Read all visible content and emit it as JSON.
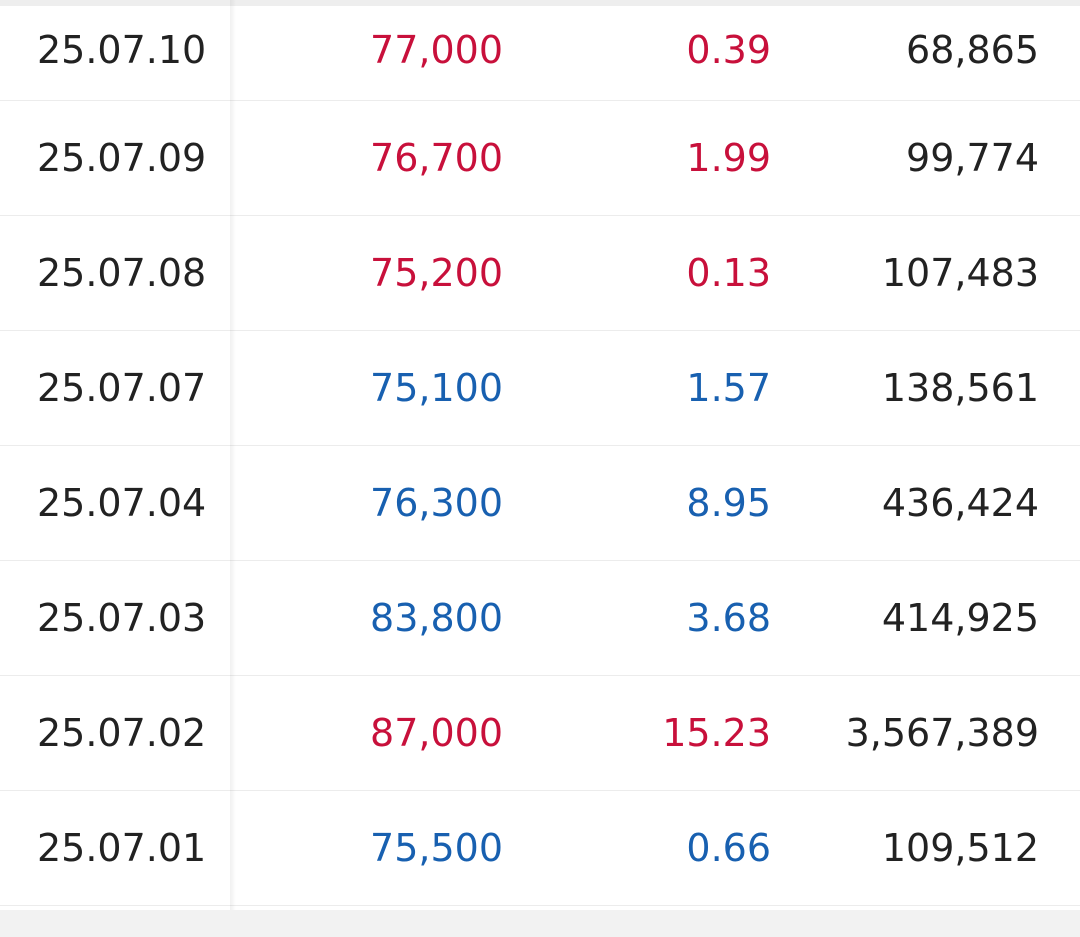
{
  "colors": {
    "up": "#c8103b",
    "down": "#1860b0",
    "text": "#222222"
  },
  "rows": [
    {
      "date": "25.07.10",
      "price": "77,000",
      "rate": "0.39",
      "volume": "68,865",
      "direction": "up"
    },
    {
      "date": "25.07.09",
      "price": "76,700",
      "rate": "1.99",
      "volume": "99,774",
      "direction": "up"
    },
    {
      "date": "25.07.08",
      "price": "75,200",
      "rate": "0.13",
      "volume": "107,483",
      "direction": "up"
    },
    {
      "date": "25.07.07",
      "price": "75,100",
      "rate": "1.57",
      "volume": "138,561",
      "direction": "down"
    },
    {
      "date": "25.07.04",
      "price": "76,300",
      "rate": "8.95",
      "volume": "436,424",
      "direction": "down"
    },
    {
      "date": "25.07.03",
      "price": "83,800",
      "rate": "3.68",
      "volume": "414,925",
      "direction": "down"
    },
    {
      "date": "25.07.02",
      "price": "87,000",
      "rate": "15.23",
      "volume": "3,567,389",
      "direction": "up"
    },
    {
      "date": "25.07.01",
      "price": "75,500",
      "rate": "0.66",
      "volume": "109,512",
      "direction": "down"
    }
  ]
}
